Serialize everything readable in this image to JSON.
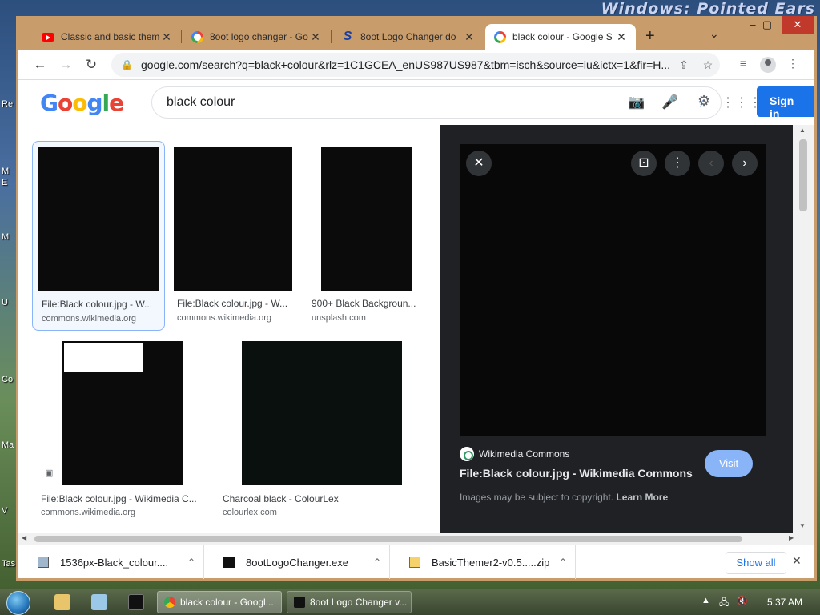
{
  "desktop": {
    "banner": "Windows: Pointed Ears",
    "icon_fragments": [
      "Re",
      "M",
      "E",
      "M",
      "U",
      "Co",
      "Ma",
      "V",
      "Tas"
    ]
  },
  "browser": {
    "tabs": [
      {
        "title": "Classic and basic theme",
        "icon": "youtube-icon"
      },
      {
        "title": "8oot logo changer - Go",
        "icon": "google-g-icon"
      },
      {
        "title": "8oot Logo Changer do",
        "icon": "s-logo-icon"
      },
      {
        "title": "black colour - Google S",
        "icon": "google-g-icon",
        "active": true
      }
    ],
    "url": "google.com/search?q=black+colour&rlz=1C1GCEA_enUS987US987&tbm=isch&source=iu&ictx=1&fir=H..."
  },
  "google": {
    "logo": "Google",
    "search_query": "black colour",
    "sign_in_label": "Sign in",
    "results": [
      {
        "title": "File:Black colour.jpg - W...",
        "source": "commons.wikimedia.org"
      },
      {
        "title": "File:Black colour.jpg - W...",
        "source": "commons.wikimedia.org"
      },
      {
        "title": "900+ Black Backgroun...",
        "source": "unsplash.com"
      },
      {
        "title": "File:Black colour.jpg - Wikimedia C...",
        "source": "commons.wikimedia.org"
      },
      {
        "title": "Charcoal black - ColourLex",
        "source": "colourlex.com"
      }
    ],
    "preview": {
      "site_name": "Wikimedia Commons",
      "title": "File:Black colour.jpg - Wikimedia Commons",
      "visit_label": "Visit",
      "copyright_text": "Images may be subject to copyright.",
      "learn_more": "Learn More"
    }
  },
  "downloads": {
    "items": [
      {
        "name": "1536px-Black_colour....",
        "icon": "image-file-icon"
      },
      {
        "name": "8ootLogoChanger.exe",
        "icon": "exe-file-icon"
      },
      {
        "name": "BasicThemer2-v0.5.....zip",
        "icon": "zip-file-icon"
      }
    ],
    "show_all_label": "Show all"
  },
  "taskbar": {
    "tasks": [
      {
        "title": "black colour - Googl...",
        "active": true
      },
      {
        "title": "8oot Logo Changer v..."
      }
    ],
    "clock": "5:37 AM"
  },
  "colors": {
    "accent_blue": "#1a73e8",
    "visit_button": "#8ab4f8",
    "window_frame": "#c99c6c",
    "preview_bg": "#202124"
  }
}
